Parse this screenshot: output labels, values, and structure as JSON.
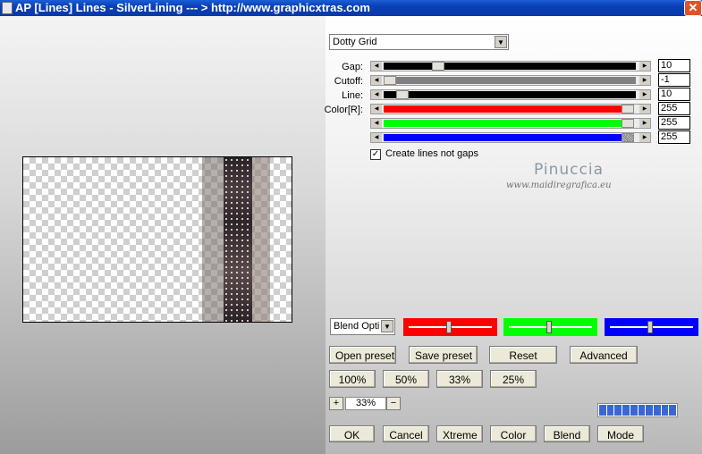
{
  "window": {
    "title": "AP [Lines]  Lines - SilverLining      --- > http://www.graphicxtras.com",
    "close_glyph": "✕"
  },
  "mode_select": {
    "value": "Dotty Grid"
  },
  "sliders": [
    {
      "label": "Gap:",
      "value": "10",
      "color": "#000000"
    },
    {
      "label": "Cutoff:",
      "value": "-1",
      "color": "#808080"
    },
    {
      "label": "Line:",
      "value": "10",
      "color": "#000000"
    },
    {
      "label": "Color[R]:",
      "value": "255",
      "color": "#ff0000"
    },
    {
      "label": "",
      "value": "255",
      "color": "#00ff00"
    },
    {
      "label": "",
      "value": "255",
      "color": "#0000ff"
    }
  ],
  "checkbox": {
    "label": "Create lines not gaps",
    "checked": true,
    "mark": "✓"
  },
  "watermark": {
    "name": "Pinuccia",
    "url": "www.maidiregrafica.eu"
  },
  "blend_select": {
    "value": "Blend Opti"
  },
  "color_bars": [
    {
      "color": "#ff0000",
      "level": 0.5
    },
    {
      "color": "#00ff00",
      "level": 0.5
    },
    {
      "color": "#0000ff",
      "level": 0.5
    }
  ],
  "preset_buttons": {
    "open": "Open preset",
    "save": "Save preset",
    "reset": "Reset",
    "advanced": "Advanced"
  },
  "zoom_buttons": [
    "100%",
    "50%",
    "33%",
    "25%"
  ],
  "zoom": {
    "plus": "+",
    "value": "33%",
    "minus": "−"
  },
  "progress": {
    "segments": 10
  },
  "bottom_buttons": {
    "ok": "OK",
    "cancel": "Cancel",
    "xtreme": "Xtreme",
    "color": "Color",
    "blend": "Blend",
    "mode": "Mode"
  }
}
